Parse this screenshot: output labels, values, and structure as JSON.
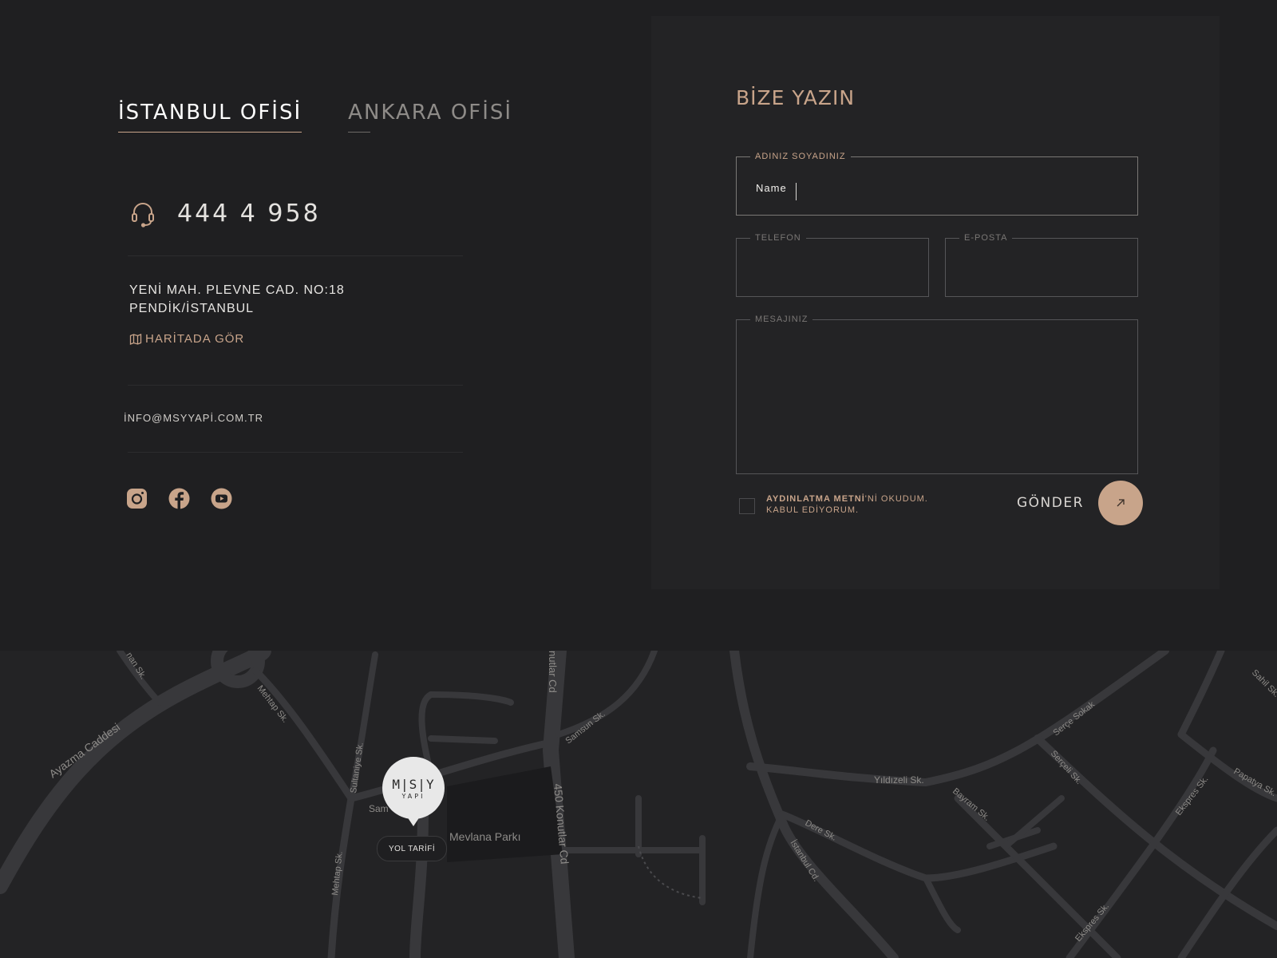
{
  "offices": {
    "tabs": [
      {
        "label": "İSTANBUL OFİSİ",
        "active": true
      },
      {
        "label": "ANKARA OFİSİ",
        "active": false
      }
    ],
    "phone": "444 4 958",
    "address_line1": "YENİ MAH. PLEVNE CAD. NO:18",
    "address_line2": "PENDİK/İSTANBUL",
    "map_link": "HARİTADA GÖR",
    "email": "İNFO@MSYYAPİ.COM.TR",
    "social_icons": [
      "instagram-icon",
      "facebook-icon",
      "youtube-icon"
    ]
  },
  "form": {
    "title": "BİZE YAZIN",
    "name_label": "ADINIZ SOYADINIZ",
    "name_value": "Name",
    "phone_label": "TELEFON",
    "email_label": "E-POSTA",
    "message_label": "MESAJINIZ",
    "consent_bold": "AYDINLATMA METNİ",
    "consent_rest": "'Nİ OKUDUM.",
    "consent_line2": "KABUL EDİYORUM.",
    "submit_label": "GÖNDER",
    "submit_icon": "arrow-up-right-icon"
  },
  "map": {
    "labels": {
      "ayazma": "Ayazma Caddesi",
      "mehtap1": "Mehtap Sk.",
      "mehtap2": "Mehtap Sk.",
      "sultaniye": "Sultaniye Sk.",
      "konutlar_top": "nutlar Cd",
      "konutlar": "450 Konutlar Cd",
      "samsun": "Samsun Sk.",
      "mevlana": "Mevlana Parkı",
      "yildizeli": "Yıldızeli Sk.",
      "dere": "Dere Sk.",
      "istanbul": "İstanbul Cd.",
      "bayram": "Bayram Sk.",
      "serce": "Serçe Sokak",
      "sercel": "Serçeli Sk.",
      "ekspres1": "Ekspres Sk.",
      "ekspres2": "Ekspres Sk.",
      "papatya": "Papatya Sk.",
      "sahil": "Sahil Sk.",
      "nan": "nan Sk.",
      "sam": "Sam"
    },
    "pin_logo": "M|S|Y",
    "pin_sub": "YAPI",
    "route_button": "YOL TARİFİ"
  },
  "colors": {
    "accent": "#c8a48a",
    "background": "#1f1f21",
    "card": "#232325"
  }
}
